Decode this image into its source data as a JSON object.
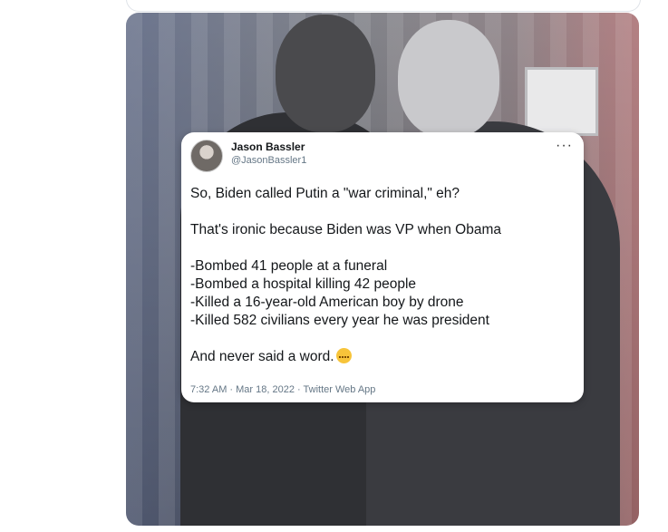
{
  "tweet": {
    "name": "Jason Bassler",
    "handle": "@JasonBassler1",
    "more": "···",
    "lines": {
      "l1": "So, Biden called Putin a \"war criminal,\" eh?",
      "l2": "That's ironic because Biden was VP when Obama",
      "l3": "-Bombed 41 people at a funeral",
      "l4": "-Bombed a hospital killing 42 people",
      "l5": "-Killed a 16-year-old American boy by drone",
      "l6": "-Killed 582 civilians every year he was president",
      "l7": "And never said a word."
    },
    "emoji": "zipper-mouth-face-icon",
    "meta": "7:32 AM · Mar 18, 2022 · Twitter Web App"
  }
}
